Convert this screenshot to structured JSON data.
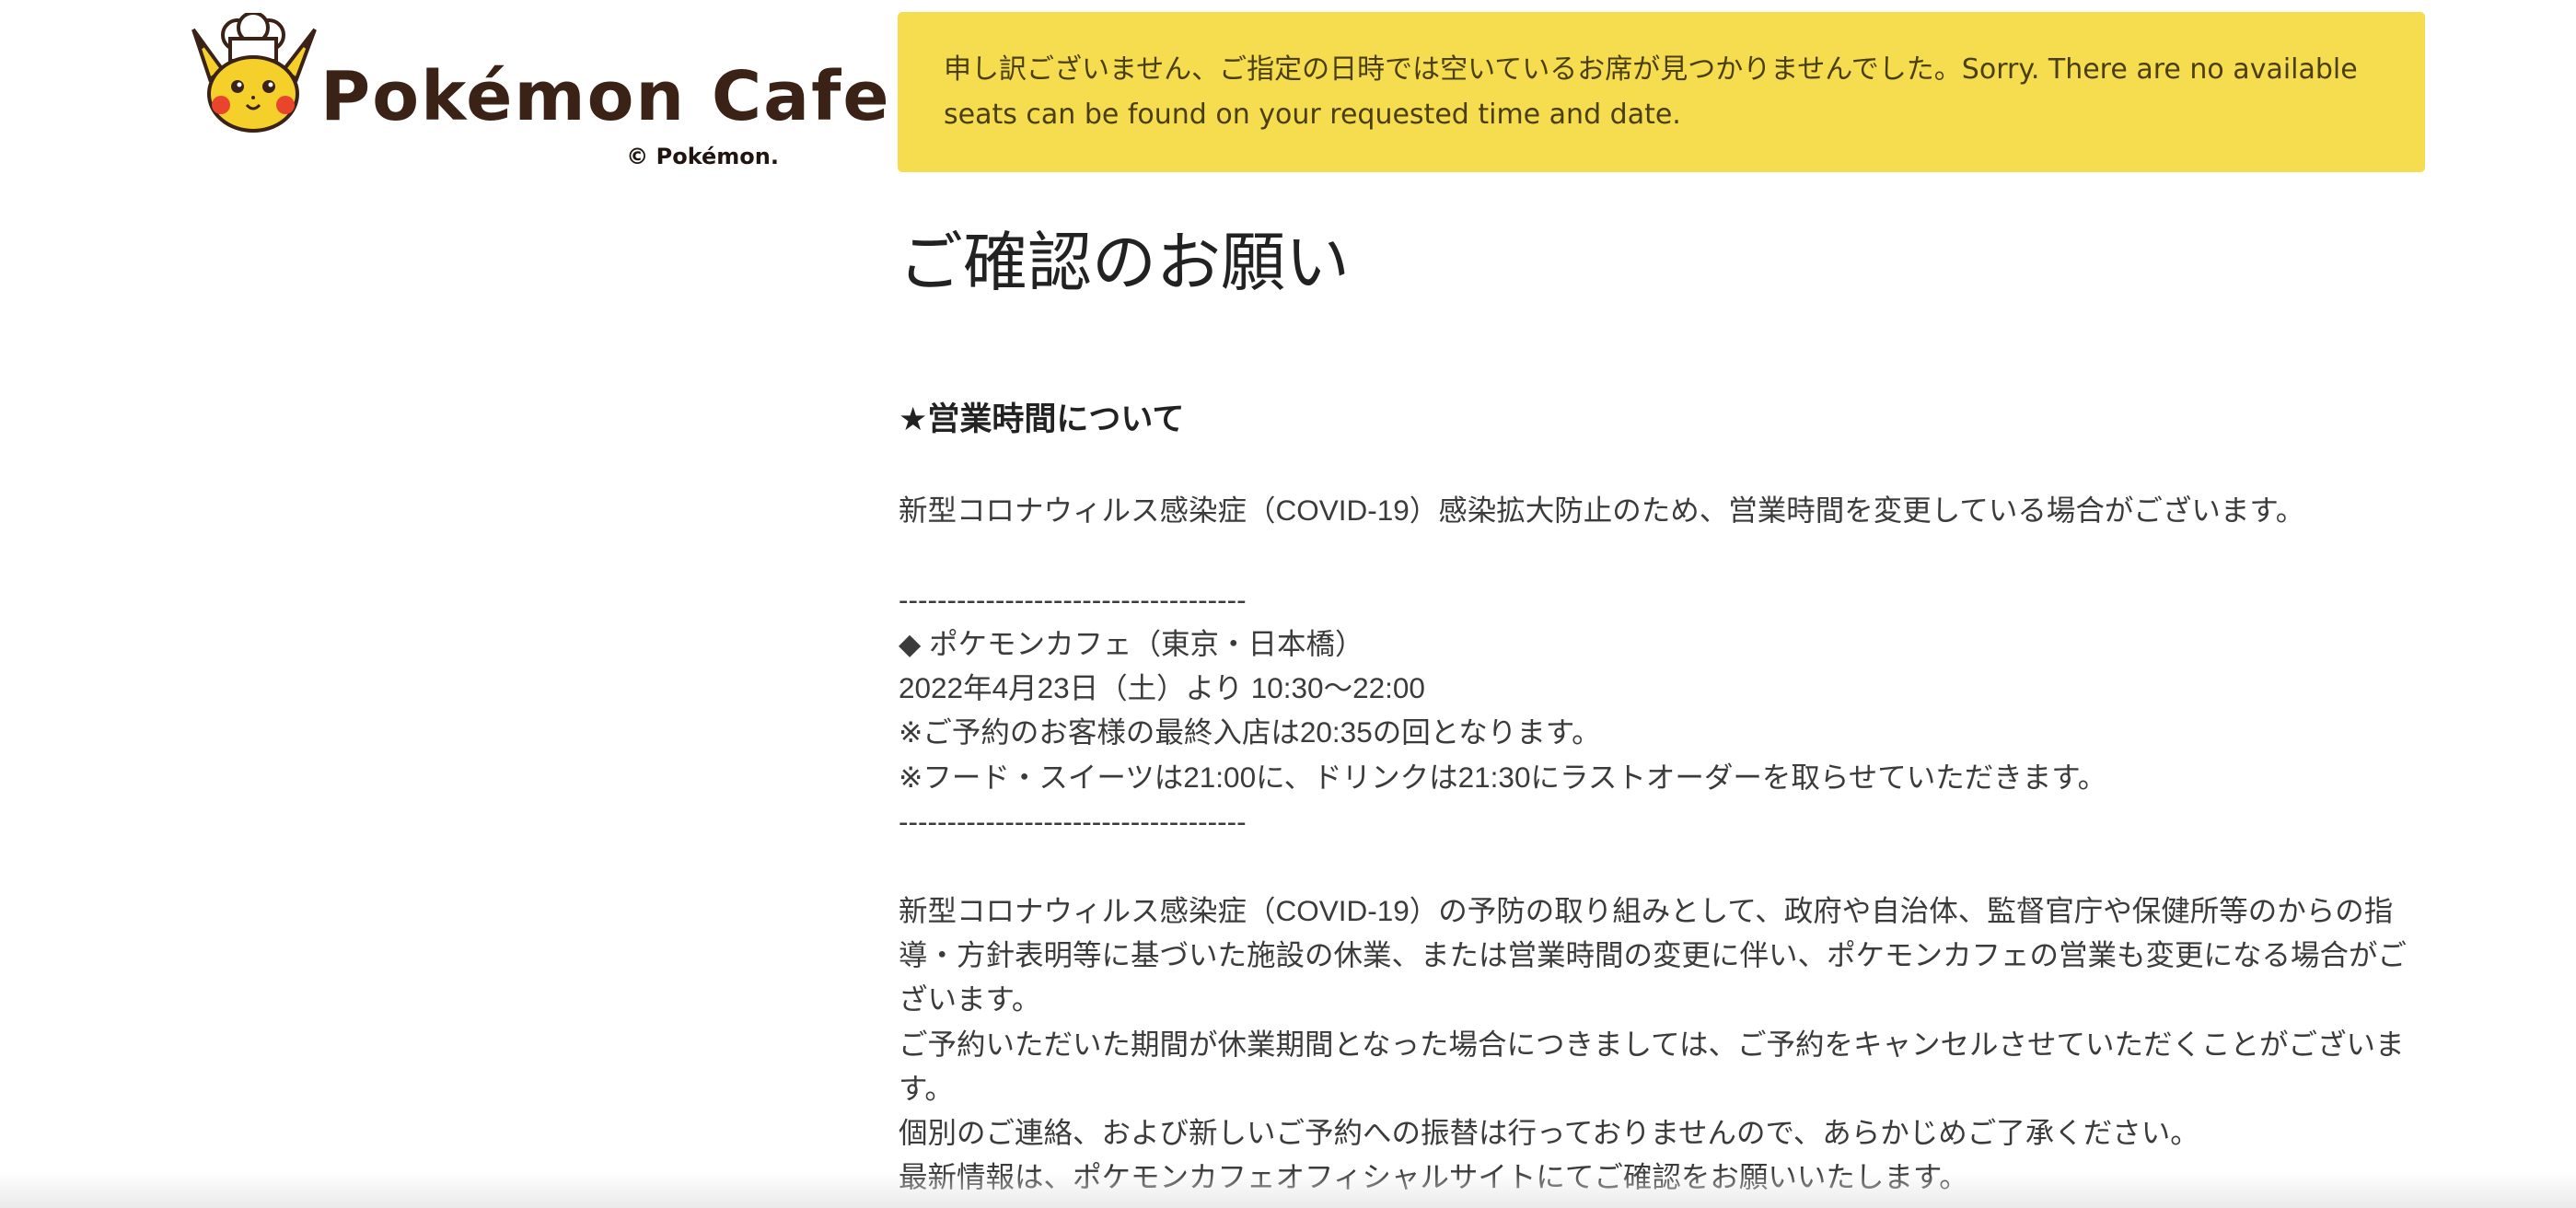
{
  "logo": {
    "wordmark": "Pokémon Cafe",
    "copyright": "© Pokémon."
  },
  "alert": {
    "message": "申し訳ございません、ご指定の日時では空いているお席が見つかりませんでした。Sorry. There are no available seats can be found on your requested time and date."
  },
  "main": {
    "title": "ご確認のお願い",
    "section_heading": "★営業時間について",
    "intro": "新型コロナウィルス感染症（COVID-19）感染拡大防止のため、営業時間を変更している場合がございます。",
    "divider": "------------------------------------",
    "store_name": "◆ ポケモンカフェ（東京・日本橋）",
    "hours": "2022年4月23日（土）より 10:30〜22:00",
    "note_last_entry": "※ご予約のお客様の最終入店は20:35の回となります。",
    "note_last_order": "※フード・スイーツは21:00に、ドリンクは21:30にラストオーダーを取らせていただきます。",
    "paragraph_1": "新型コロナウィルス感染症（COVID-19）の予防の取り組みとして、政府や自治体、監督官庁や保健所等のからの指導・方針表明等に基づいた施設の休業、または営業時間の変更に伴い、ポケモンカフェの営業も変更になる場合がございます。",
    "paragraph_2": "ご予約いただいた期間が休業期間となった場合につきましては、ご予約をキャンセルさせていただくことがございます。",
    "paragraph_3": "個別のご連絡、および新しいご予約への振替は行っておりませんので、あらかじめご了承ください。",
    "paragraph_4": "最新情報は、ポケモンカフェオフィシャルサイトにてご確認をお願いいたします。"
  },
  "colors": {
    "alert_background": "#f6dc4f",
    "logo_brown": "#3a2316",
    "pikachu_yellow": "#f5d02b",
    "cheek_red": "#e8452c"
  }
}
